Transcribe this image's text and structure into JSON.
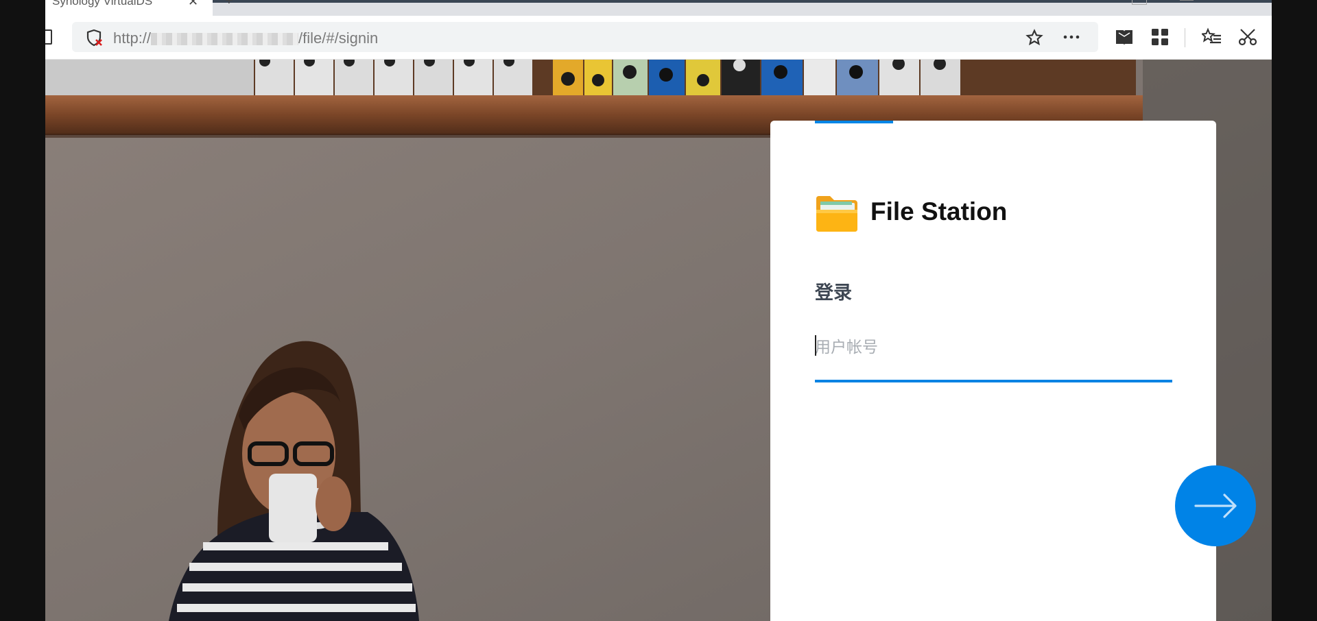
{
  "browser": {
    "tab_title": "Synology VirtualDS",
    "tab_close": "✕",
    "new_tab": "+",
    "url_prefix": "http://",
    "url_suffix": "/file/#/signin"
  },
  "signin": {
    "app_name": "File Station",
    "heading": "登录",
    "username_placeholder": "用户帐号",
    "next_button": "next"
  },
  "colors": {
    "accent": "#0086e6",
    "button": "#0083e7",
    "heading": "#3e4753"
  },
  "icons": [
    "shield-blocked-icon",
    "star-icon",
    "more-icon",
    "reading-view-icon",
    "apps-icon",
    "favorites-icon",
    "cut-icon",
    "folder-icon",
    "arrow-right-icon"
  ]
}
